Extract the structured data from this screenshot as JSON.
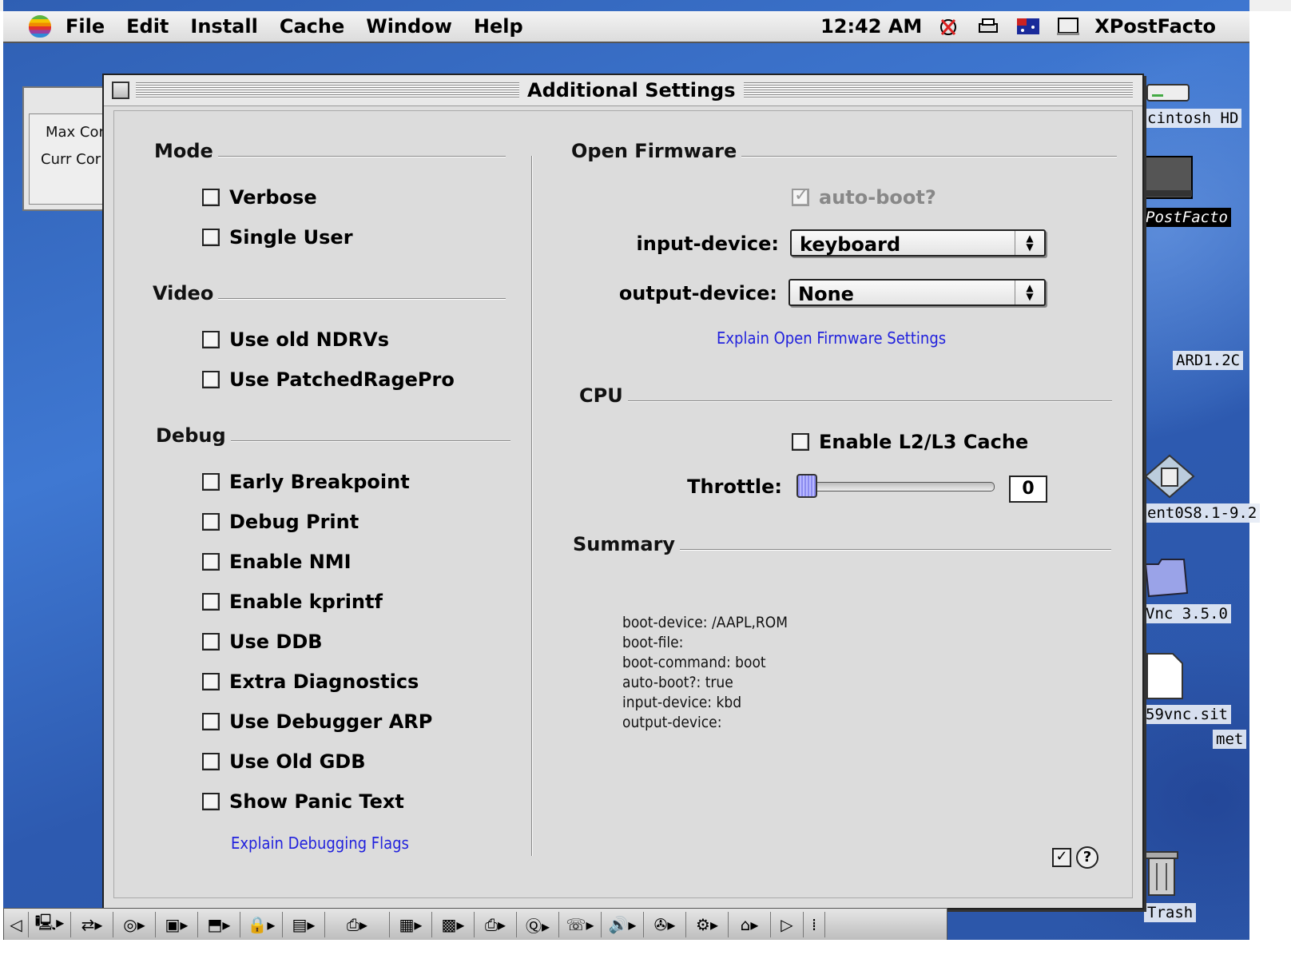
{
  "menubar": {
    "items": [
      "File",
      "Edit",
      "Install",
      "Cache",
      "Window",
      "Help"
    ],
    "clock": "12:42 AM",
    "app_name": "XPostFacto"
  },
  "background_window": {
    "line1": "Max Cor",
    "line2": "Curr Cor"
  },
  "desktop_icons": {
    "hd": "cintosh HD",
    "postfacto": "PostFacto",
    "ard": "ARD1.2C",
    "os": "ent0S8.1-9.2",
    "vnc": "Vnc 3.5.0",
    "sit": "59vnc.sit",
    "met": "met",
    "trash": "Trash"
  },
  "window": {
    "title": "Additional Settings",
    "mode": {
      "heading": "Mode",
      "options": [
        "Verbose",
        "Single User"
      ]
    },
    "video": {
      "heading": "Video",
      "options": [
        "Use old NDRVs",
        "Use PatchedRagePro"
      ]
    },
    "debug": {
      "heading": "Debug",
      "options": [
        "Early Breakpoint",
        "Debug Print",
        "Enable NMI",
        "Enable kprintf",
        "Use DDB",
        "Extra Diagnostics",
        "Use Debugger ARP",
        "Use Old GDB",
        "Show Panic Text"
      ],
      "explain_link": "Explain Debugging Flags"
    },
    "open_firmware": {
      "heading": "Open Firmware",
      "auto_boot_label": "auto-boot?",
      "input_device_label": "input-device:",
      "input_device_value": "keyboard",
      "output_device_label": "output-device:",
      "output_device_value": "None",
      "explain_link": "Explain Open Firmware Settings"
    },
    "cpu": {
      "heading": "CPU",
      "cache_label": "Enable L2/L3 Cache",
      "throttle_label": "Throttle:",
      "throttle_value": "0"
    },
    "summary": {
      "heading": "Summary",
      "lines": [
        "boot-device: /AAPL,ROM",
        "boot-file:",
        "boot-command: boot",
        "auto-boot?: true",
        "input-device: kbd",
        "output-device:"
      ]
    }
  },
  "colors": {
    "desktop": "#3a6cc4",
    "window_bg": "#dcdcdc",
    "link": "#2222dd"
  }
}
